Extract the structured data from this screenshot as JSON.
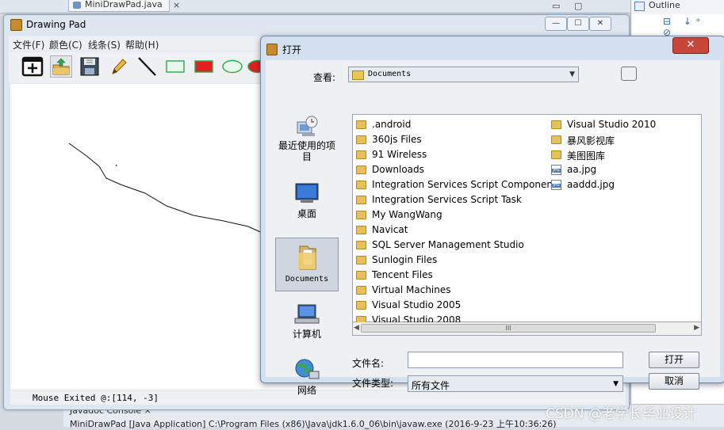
{
  "ide": {
    "editor_tab": "MiniDrawPad.java",
    "close_glyph": "×",
    "outline_tab": "Outline",
    "outline_icons": "⊟ ↓ᵃ ⊘",
    "bottom_tabs": "Javadoc  Console  ×",
    "console_line": "MiniDrawPad [Java Application] C:\\Program Files (x86)\\Java\\jdk1.6.0_06\\bin\\javaw.exe (2016-9-23 上午10:36:26)",
    "watermark": "CSDN @老学长毕业设计"
  },
  "drawing_pad": {
    "title": "Drawing Pad",
    "controls": {
      "minimize": "—",
      "maximize": "☐",
      "close": "✕"
    },
    "menu": [
      "文件(F)",
      "颜色(C)",
      "线条(S)",
      "帮助(H)"
    ],
    "toolbar": [
      {
        "icon": "new-file-icon"
      },
      {
        "icon": "open-file-icon"
      },
      {
        "icon": "save-icon"
      },
      {
        "icon": "pencil-icon"
      },
      {
        "icon": "line-icon"
      },
      {
        "icon": "rectangle-icon"
      },
      {
        "icon": "filled-rectangle-icon"
      },
      {
        "icon": "oval-icon"
      },
      {
        "icon": "filled-oval-icon"
      }
    ],
    "status": "Mouse Exited @:[114, -3]",
    "accent_red": "#e02020",
    "accent_green": "#2ea84a"
  },
  "open_dialog": {
    "title": "打开",
    "close": "✕",
    "look_in_label": "查看:",
    "look_in_value": "Documents",
    "places": [
      {
        "label": "最近使用的项目",
        "icon": "recent-items-icon"
      },
      {
        "label": "桌面",
        "icon": "desktop-icon"
      },
      {
        "label": "Documents",
        "icon": "documents-folder-icon"
      },
      {
        "label": "计算机",
        "icon": "computer-icon"
      },
      {
        "label": "网络",
        "icon": "network-icon"
      }
    ],
    "files": [
      {
        "name": ".android",
        "type": "folder"
      },
      {
        "name": "360js Files",
        "type": "folder"
      },
      {
        "name": "91 Wireless",
        "type": "folder"
      },
      {
        "name": "Downloads",
        "type": "folder"
      },
      {
        "name": "Integration Services Script Component",
        "type": "folder"
      },
      {
        "name": "Integration Services Script Task",
        "type": "folder"
      },
      {
        "name": "My WangWang",
        "type": "folder"
      },
      {
        "name": "Navicat",
        "type": "folder"
      },
      {
        "name": "SQL Server Management Studio",
        "type": "folder"
      },
      {
        "name": "Sunlogin Files",
        "type": "folder"
      },
      {
        "name": "Tencent Files",
        "type": "folder"
      },
      {
        "name": "Virtual Machines",
        "type": "folder"
      },
      {
        "name": "Visual Studio 2005",
        "type": "folder"
      },
      {
        "name": "Visual Studio 2008",
        "type": "folder"
      },
      {
        "name": "Visual Studio 2010",
        "type": "folder"
      },
      {
        "name": "暴风影视库",
        "type": "folder"
      },
      {
        "name": "美图图库",
        "type": "folder"
      },
      {
        "name": "aa.jpg",
        "type": "image"
      },
      {
        "name": "aaddd.jpg",
        "type": "image"
      }
    ],
    "scroll_grip": "III",
    "filename_label": "文件名:",
    "filename_value": "",
    "filetype_label": "文件类型:",
    "filetype_value": "所有文件",
    "open_button": "打开",
    "cancel_button": "取消"
  }
}
